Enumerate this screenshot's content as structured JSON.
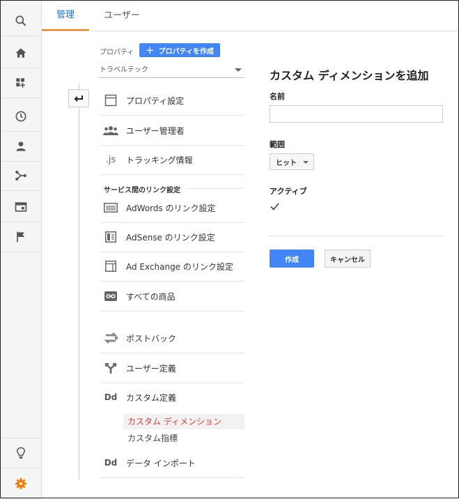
{
  "tabs": {
    "admin": "管理",
    "user": "ユーザー"
  },
  "property": {
    "label": "プロパティ",
    "create_button": "プロパティを作成",
    "selected": "トラベルテック"
  },
  "menu": {
    "property_settings": "プロパティ設定",
    "user_management": "ユーザー管理者",
    "tracking_info": "トラッキング情報",
    "js_icon_text": ".js",
    "link_section_title": "サービス間のリンク設定",
    "adwords": "AdWords のリンク設定",
    "adsense": "AdSense のリンク設定",
    "adexchange": "Ad Exchange のリンク設定",
    "all_products": "すべての商品",
    "postback": "ポストバック",
    "user_definitions": "ユーザー定義",
    "custom_definitions": "カスタム定義",
    "dd_icon_text": "Dd",
    "custom_dimensions": "カスタム ディメンション",
    "custom_metrics": "カスタム指標",
    "data_import": "データ インポート"
  },
  "panel": {
    "title": "カスタム ディメンションを追加",
    "name_label": "名前",
    "name_value": "",
    "scope_label": "範囲",
    "scope_value": "ヒット",
    "active_label": "アクティブ",
    "active_checked": true,
    "create_button": "作成",
    "cancel_button": "キャンセル"
  },
  "colors": {
    "accent": "#4285f4",
    "active_tab_underline": "#f57c00",
    "active_item": "#e53935",
    "gear": "#f57c00"
  }
}
